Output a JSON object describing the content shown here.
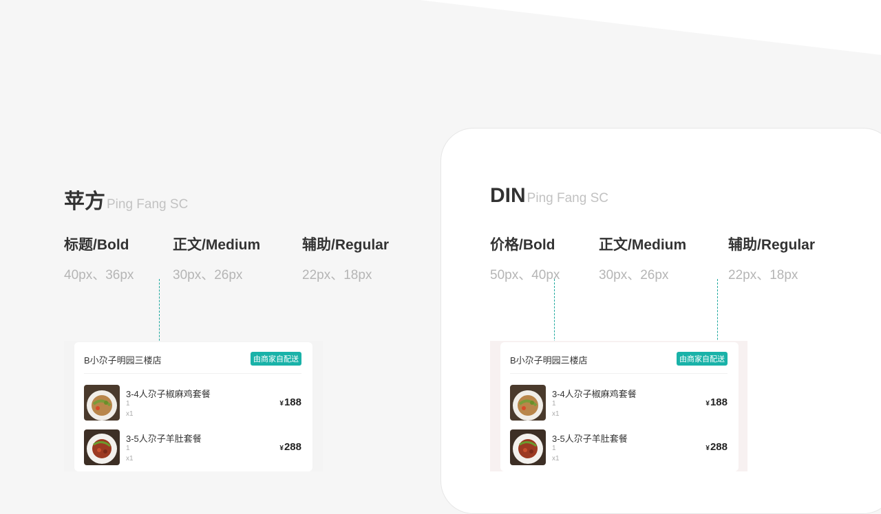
{
  "left": {
    "title": "苹方",
    "subtitle": "Ping Fang SC",
    "styles": [
      {
        "name": "标题/Bold",
        "size": "40px、36px"
      },
      {
        "name": "正文/Medium",
        "size": "30px、26px"
      },
      {
        "name": "辅助/Regular",
        "size": "22px、18px"
      }
    ]
  },
  "right": {
    "title": "DIN",
    "subtitle": "Ping Fang SC",
    "styles": [
      {
        "name": "价格/Bold",
        "size": "50px、40px"
      },
      {
        "name": "正文/Medium",
        "size": "30px、26px"
      },
      {
        "name": "辅助/Regular",
        "size": "22px、18px"
      }
    ]
  },
  "order": {
    "shop_name": "B小尕子明园三楼店",
    "delivery_badge": "由商家自配送",
    "items": [
      {
        "name": "3-4人尕子椒麻鸡套餐",
        "spec": "1",
        "qty": "x1",
        "currency": "¥",
        "price": "188"
      },
      {
        "name": "3-5人尕子羊肚套餐",
        "spec": "1",
        "qty": "x1",
        "currency": "¥",
        "price": "288"
      }
    ]
  },
  "colors": {
    "accent": "#19b2a8",
    "background": "#f6f6f6",
    "panel": "#ffffff"
  }
}
